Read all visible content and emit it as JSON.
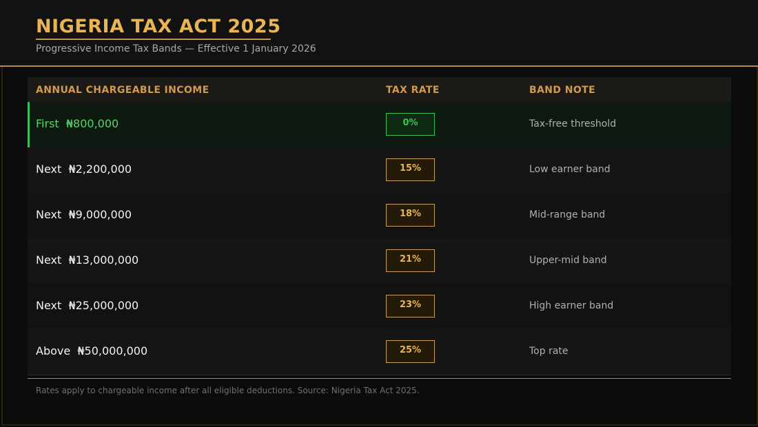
{
  "header": {
    "title": "NIGERIA TAX ACT 2025",
    "subtitle": "Progressive Income Tax Bands — Effective 1 January 2026"
  },
  "colors": {
    "accent": "#e8b454",
    "header_text": "#d29a4a",
    "highlight_green": "#3bbf5a",
    "background": "#0b0b0b"
  },
  "table": {
    "columns": [
      "ANNUAL CHARGEABLE INCOME",
      "TAX RATE",
      "BAND NOTE"
    ],
    "rows": [
      {
        "income": "First  ₦800,000",
        "rate": "0%",
        "note": "Tax-free threshold"
      },
      {
        "income": "Next  ₦2,200,000",
        "rate": "15%",
        "note": "Low earner band"
      },
      {
        "income": "Next  ₦9,000,000",
        "rate": "18%",
        "note": "Mid-range band"
      },
      {
        "income": "Next  ₦13,000,000",
        "rate": "21%",
        "note": "Upper-mid band"
      },
      {
        "income": "Next  ₦25,000,000",
        "rate": "23%",
        "note": "High earner band"
      },
      {
        "income": "Above  ₦50,000,000",
        "rate": "25%",
        "note": "Top rate"
      }
    ]
  },
  "footer": {
    "note": "Rates apply to chargeable income after all eligible deductions. Source: Nigeria Tax Act 2025."
  }
}
